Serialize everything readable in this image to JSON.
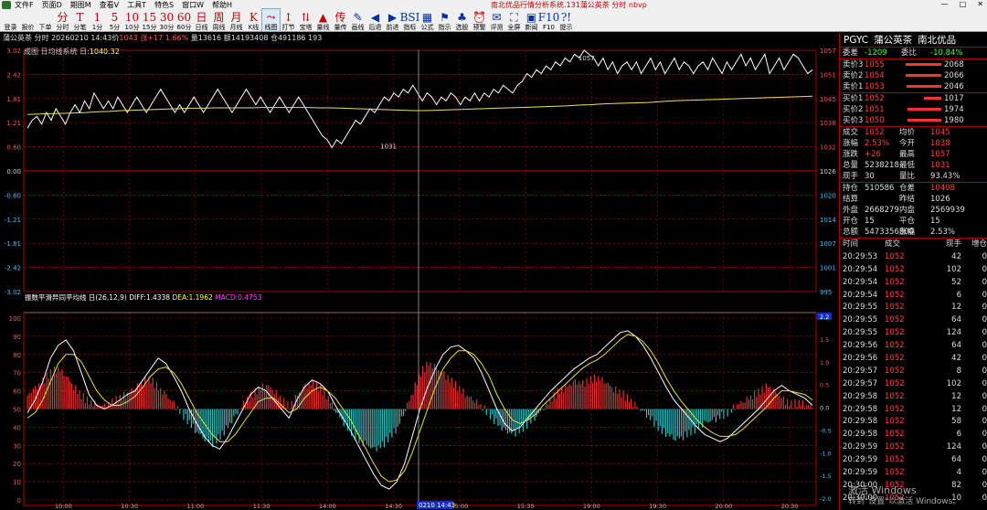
{
  "window": {
    "title": "南北优品行情分析系统.131蒲公英茶 分时 nbvp",
    "controls": [
      "—",
      "□",
      "✕"
    ]
  },
  "menu": [
    "文件F",
    "页面D",
    "期图M",
    "查看V",
    "工具T",
    "特色S",
    "窗口W",
    "帮助H"
  ],
  "toolbar": [
    {
      "g": "",
      "l": "登录",
      "icon": "login-icon"
    },
    {
      "g": "",
      "l": "报价",
      "icon": "quote-icon"
    },
    {
      "g": "",
      "l": "下单",
      "icon": "order-icon"
    },
    {
      "g": "分",
      "l": "分时",
      "icon": "timeshare-icon"
    },
    {
      "g": "T",
      "l": "分笔",
      "icon": "tick-icon"
    },
    {
      "g": "1",
      "l": "1分",
      "icon": "1min-icon"
    },
    {
      "g": "5",
      "l": "5分",
      "icon": "5min-icon"
    },
    {
      "g": "10",
      "l": "10分",
      "icon": "10min-icon"
    },
    {
      "g": "15",
      "l": "15分",
      "icon": "15min-icon"
    },
    {
      "g": "30",
      "l": "30分",
      "icon": "30min-icon"
    },
    {
      "g": "60",
      "l": "60分",
      "icon": "60min-icon"
    },
    {
      "g": "日",
      "l": "日线",
      "icon": "day-icon"
    },
    {
      "g": "周",
      "l": "周线",
      "icon": "week-icon"
    },
    {
      "g": "月",
      "l": "月线",
      "icon": "month-icon"
    },
    {
      "g": "K",
      "l": "K线",
      "icon": "kline-icon"
    },
    {
      "g": "⤳",
      "l": "线图",
      "icon": "linechart-icon"
    },
    {
      "g": "↕",
      "l": "打节",
      "icon": "bar-icon"
    },
    {
      "g": "⇅",
      "l": "宝塔",
      "icon": "tower-icon"
    },
    {
      "g": "▲",
      "l": "量线",
      "icon": "volume-icon"
    },
    {
      "g": "传",
      "l": "量传",
      "icon": "vtrans-icon"
    },
    {
      "g": "✎",
      "l": "画线",
      "icon": "draw-icon"
    },
    {
      "g": "◀",
      "l": "后退",
      "icon": "back-icon"
    },
    {
      "g": "▶",
      "l": "前进",
      "icon": "forward-icon"
    },
    {
      "g": "BSI",
      "l": "指标",
      "icon": "indicator-icon"
    },
    {
      "g": "▦",
      "l": "公式",
      "icon": "formula-icon"
    },
    {
      "g": "⚑",
      "l": "指示",
      "icon": "indicate-icon"
    },
    {
      "g": "♣",
      "l": "选股",
      "icon": "select-icon"
    },
    {
      "g": "⏰",
      "l": "预警",
      "icon": "alarm-icon"
    },
    {
      "g": "✉",
      "l": "评测",
      "icon": "eval-icon"
    },
    {
      "g": "⛶",
      "l": "全屏",
      "icon": "fullscreen-icon"
    },
    {
      "g": "▣",
      "l": "新闻",
      "icon": "news-icon"
    },
    {
      "g": "F10",
      "l": "F10",
      "icon": "f10-icon"
    },
    {
      "g": "?!",
      "l": "提示",
      "icon": "hint-icon"
    }
  ],
  "info_bar": {
    "name": "蒲公英茶 分时 20260210 14:43价",
    "price": "1043",
    "change": "涨+17 1.66%",
    "rest": "量13616 额14193408 仓491186 193"
  },
  "price_legend": {
    "text": "成图 日均线系统 日:",
    "val": "1040.32"
  },
  "macd_legend": {
    "text": "振数平滑异同平均线 日(26,12,9)",
    "diff": "DIFF:1.4338",
    "dea": "DEA:1.1962",
    "macd": "MACD:0.4753"
  },
  "cursor_label": "0210 14:43",
  "chart_data": [
    {
      "type": "line",
      "name": "price",
      "left_ticks": [
        "3.02",
        "2.42",
        "1.81",
        "1.21",
        "0.60",
        "0.00",
        "-0.60",
        "-1.21",
        "-1.81",
        "-2.42",
        "-3.02"
      ],
      "right_ticks": [
        "1057",
        "1051",
        "1045",
        "1038",
        "1032",
        "1026",
        "1020",
        "1014",
        "1007",
        "1001",
        "995"
      ],
      "ylim": [
        995,
        1057
      ],
      "annotations": [
        {
          "text": "1057",
          "x": 0.7,
          "y": 1057
        },
        {
          "text": "1031",
          "x": 0.45,
          "y": 1031
        }
      ],
      "series": [
        {
          "values": [
            1037,
            1039,
            1040,
            1038,
            1041,
            1039,
            1042,
            1040,
            1038,
            1041,
            1043,
            1041,
            1044,
            1042,
            1046,
            1044,
            1042,
            1044,
            1042,
            1045,
            1043,
            1041,
            1043,
            1045,
            1043,
            1041,
            1043,
            1045,
            1047,
            1045,
            1043,
            1041,
            1043,
            1041,
            1043,
            1045,
            1043,
            1041,
            1043,
            1045,
            1047,
            1045,
            1043,
            1041,
            1043,
            1045,
            1047,
            1045,
            1043,
            1045,
            1043,
            1041,
            1043,
            1045,
            1043,
            1041,
            1043,
            1045,
            1043,
            1041,
            1039,
            1037,
            1035,
            1034,
            1032,
            1034,
            1033,
            1035,
            1037,
            1039,
            1038,
            1040,
            1042,
            1041,
            1043,
            1045,
            1044,
            1046,
            1045,
            1047,
            1046,
            1048,
            1046,
            1044,
            1046,
            1045,
            1043,
            1045,
            1044,
            1046,
            1045,
            1043,
            1045,
            1044,
            1046,
            1044,
            1046,
            1045,
            1047,
            1046,
            1048,
            1047,
            1046,
            1048,
            1049,
            1051,
            1050,
            1052,
            1051,
            1053,
            1052,
            1054,
            1053,
            1055,
            1054,
            1056,
            1055,
            1057,
            1056,
            1055,
            1053,
            1055,
            1052,
            1054,
            1051,
            1053,
            1054,
            1052,
            1054,
            1051,
            1053,
            1055,
            1052,
            1054,
            1051,
            1053,
            1055,
            1052,
            1054,
            1053,
            1051,
            1053,
            1054,
            1052,
            1055,
            1053,
            1051,
            1054,
            1052,
            1054,
            1056,
            1053,
            1055,
            1052,
            1054,
            1056,
            1051,
            1053,
            1055,
            1052,
            1054,
            1056,
            1055,
            1053,
            1051,
            1052
          ]
        },
        {
          "values": [
            1040.5,
            1040.6,
            1040.7,
            1040.8,
            1040.9,
            1041,
            1041.2,
            1041.3,
            1041.5,
            1041.6,
            1041.7,
            1041.8,
            1041.9,
            1042,
            1042.1,
            1042.1,
            1042.2,
            1042.2,
            1042.2,
            1042.2,
            1042.3,
            1042.3,
            1042.3,
            1042.3,
            1042.3,
            1042.2,
            1042.2,
            1042.1,
            1042,
            1041.9,
            1041.8,
            1041.7,
            1041.6,
            1041.5,
            1041.5,
            1041.6,
            1041.7,
            1041.8,
            1041.9,
            1042,
            1042.1,
            1042.2,
            1042.3,
            1042.4,
            1042.5,
            1042.6,
            1042.7,
            1042.9,
            1043,
            1043.2,
            1043.3,
            1043.4,
            1043.5,
            1043.6,
            1043.8,
            1044,
            1044.1,
            1044.2,
            1044.3,
            1044.4,
            1044.5,
            1044.6,
            1044.7,
            1044.8,
            1044.9,
            1045,
            1045.1,
            1045.2
          ]
        }
      ]
    },
    {
      "type": "line",
      "name": "indicator",
      "left_ticks": [
        "100",
        "90",
        "80",
        "70",
        "60",
        "50",
        "40",
        "30",
        "20",
        "10",
        "0"
      ],
      "right_ticks": [
        "2.2",
        "1.5",
        "1.0",
        "0.5",
        "0.0",
        "-0.5",
        "-1.0",
        "-1.5",
        "-2.0"
      ],
      "ylim": [
        0,
        100
      ],
      "series": [
        {
          "values": [
            48,
            55,
            65,
            78,
            85,
            88,
            82,
            70,
            58,
            52,
            50,
            52,
            55,
            58,
            60,
            66,
            72,
            78,
            75,
            68,
            60,
            50,
            42,
            35,
            30,
            28,
            34,
            42,
            50,
            58,
            62,
            60,
            55,
            50,
            45,
            55,
            62,
            66,
            64,
            60,
            52,
            45,
            38,
            30,
            22,
            14,
            8,
            6,
            10,
            20,
            35,
            50,
            62,
            72,
            80,
            84,
            85,
            82,
            78,
            70,
            60,
            50,
            42,
            38,
            40,
            45,
            50,
            55,
            60,
            64,
            68,
            72,
            75,
            78,
            80,
            84,
            88,
            92,
            93,
            90,
            85,
            78,
            70,
            62,
            55,
            50,
            45,
            40,
            36,
            34,
            32,
            34,
            38,
            42,
            46,
            50,
            55,
            60,
            63,
            60,
            58,
            56,
            52
          ]
        },
        {
          "values": [
            45,
            48,
            55,
            65,
            75,
            80,
            80,
            76,
            68,
            60,
            55,
            52,
            52,
            54,
            57,
            62,
            68,
            72,
            73,
            70,
            64,
            56,
            48,
            42,
            36,
            32,
            32,
            36,
            42,
            48,
            54,
            56,
            56,
            52,
            48,
            50,
            56,
            60,
            62,
            60,
            56,
            50,
            44,
            36,
            28,
            20,
            13,
            10,
            11,
            16,
            26,
            38,
            50,
            62,
            72,
            78,
            82,
            82,
            80,
            75,
            68,
            58,
            50,
            44,
            42,
            44,
            47,
            52,
            56,
            60,
            64,
            68,
            72,
            75,
            77,
            80,
            84,
            88,
            91,
            90,
            87,
            82,
            75,
            67,
            60,
            54,
            49,
            44,
            40,
            37,
            35,
            35,
            36,
            39,
            43,
            47,
            51,
            56,
            60,
            60,
            59,
            58,
            55
          ]
        },
        {
          "values": [
            0.6,
            0.9,
            1.2,
            1.6,
            1.8,
            1.5,
            1.0,
            0.6,
            0.3,
            0.2,
            0.1,
            0.3,
            0.5,
            0.7,
            1.0,
            1.2,
            1.3,
            0.9,
            0.6,
            0.2,
            -0.2,
            -0.6,
            -1.0,
            -1.3,
            -1.5,
            -1.2,
            -0.8,
            -0.3,
            0.2,
            0.6,
            0.9,
            1.1,
            0.8,
            0.4,
            0.1,
            0.6,
            1.0,
            1.1,
            0.9,
            0.5,
            -0.1,
            -0.6,
            -1.0,
            -1.4,
            -1.6,
            -1.8,
            -1.6,
            -1.2,
            -0.8,
            0.0,
            0.8,
            1.6,
            2.0,
            1.8,
            1.5,
            1.2,
            0.9,
            0.6,
            0.4,
            0.1,
            -0.3,
            -0.7,
            -1.0,
            -1.1,
            -0.9,
            -0.6,
            -0.3,
            0.1,
            0.5,
            0.8,
            1.0,
            1.2,
            1.1,
            1.3,
            1.4,
            1.2,
            0.9,
            0.7,
            0.4,
            0.1,
            -0.2,
            -0.5,
            -0.9,
            -1.1,
            -1.3,
            -1.2,
            -1.0,
            -0.8,
            -0.6,
            -0.5,
            -0.3,
            -0.1,
            0.2,
            0.4,
            0.6,
            0.8,
            1.0,
            0.7,
            0.4,
            0.2,
            0.3,
            0.2,
            0.1
          ]
        }
      ]
    }
  ],
  "x_ticks": [
    "10:00",
    "10:30",
    "11:00",
    "11:30",
    "14:00",
    "14:30",
    "15:00",
    "15:30",
    "19:00",
    "19:30",
    "20:00",
    "20:30"
  ],
  "right_panel": {
    "code": "PGYC",
    "name": "蒲公英茶",
    "category": "南北优品",
    "weibi": {
      "l1": "委差",
      "v1": "-1209",
      "l2": "委比",
      "v2": "-10.84%"
    },
    "asks": [
      {
        "label": "卖价3",
        "price": "1055",
        "vol": "2068",
        "bar": 0.97
      },
      {
        "label": "卖价2",
        "price": "1054",
        "vol": "2066",
        "bar": 0.97
      },
      {
        "label": "卖价1",
        "price": "1053",
        "vol": "2046",
        "bar": 0.96
      }
    ],
    "bids": [
      {
        "label": "买价1",
        "price": "1052",
        "vol": "1017",
        "bar": 0.48
      },
      {
        "label": "买价2",
        "price": "1051",
        "vol": "1974",
        "bar": 0.93
      },
      {
        "label": "买价3",
        "price": "1050",
        "vol": "1980",
        "bar": 0.93
      }
    ],
    "stats": [
      {
        "k1": "成交",
        "v1": "1052",
        "c1": "red",
        "k2": "均价",
        "v2": "1045",
        "c2": "red"
      },
      {
        "k1": "涨幅",
        "v1": "2.53%",
        "c1": "red",
        "k2": "今开",
        "v2": "1038",
        "c2": "red"
      },
      {
        "k1": "涨跌",
        "v1": "+26",
        "c1": "red",
        "k2": "最高",
        "v2": "1057",
        "c2": "red"
      },
      {
        "k1": "总量",
        "v1": "5238218",
        "c1": "white",
        "k2": "最低",
        "v2": "1031",
        "c2": "red"
      },
      {
        "k1": "现手",
        "v1": "30",
        "c1": "white",
        "k2": "量比",
        "v2": "93.43%",
        "c2": "white"
      }
    ],
    "stats2": [
      {
        "k1": "持仓",
        "v1": "510586",
        "c1": "white",
        "k2": "仓差",
        "v2": "10408",
        "c2": "red"
      },
      {
        "k1": "结算",
        "v1": "",
        "c1": "white",
        "k2": "昨结",
        "v2": "1026",
        "c2": "white"
      },
      {
        "k1": "外盘",
        "v1": "2668279",
        "c1": "white",
        "k2": "内盘",
        "v2": "2569939",
        "c2": "white"
      },
      {
        "k1": "开仓",
        "v1": "15",
        "c1": "white",
        "k2": "平仓",
        "v2": "15",
        "c2": "white"
      },
      {
        "k1": "总额",
        "v1": "5473356800",
        "c1": "white",
        "k2": "涨幅",
        "v2": "2.53%",
        "c2": "white"
      }
    ],
    "trades_header": [
      "时间",
      "成交",
      "现手",
      "增仓"
    ],
    "trades": [
      [
        "20:29:53",
        "1052",
        "42",
        "0"
      ],
      [
        "20:29:54",
        "1052",
        "102",
        "0"
      ],
      [
        "20:29:54",
        "1052",
        "52",
        "0"
      ],
      [
        "20:29:54",
        "1052",
        "6",
        "0"
      ],
      [
        "20:29:55",
        "1052",
        "12",
        "0"
      ],
      [
        "20:29:55",
        "1052",
        "64",
        "0"
      ],
      [
        "20:29:55",
        "1052",
        "124",
        "0"
      ],
      [
        "20:29:56",
        "1052",
        "64",
        "0"
      ],
      [
        "20:29:56",
        "1052",
        "42",
        "0"
      ],
      [
        "20:29:57",
        "1052",
        "8",
        "0"
      ],
      [
        "20:29:57",
        "1052",
        "102",
        "0"
      ],
      [
        "20:29:58",
        "1052",
        "12",
        "0"
      ],
      [
        "20:29:58",
        "1052",
        "12",
        "0"
      ],
      [
        "20:29:58",
        "1052",
        "58",
        "0"
      ],
      [
        "20:29:58",
        "1052",
        "6",
        "0"
      ],
      [
        "20:29:59",
        "1052",
        "124",
        "0"
      ],
      [
        "20:29:59",
        "1052",
        "64",
        "0"
      ],
      [
        "20:29:59",
        "1052",
        "4",
        "0"
      ],
      [
        "20:30:00",
        "1052",
        "82",
        "0"
      ],
      [
        "20:30:00",
        "1052",
        "10",
        "0"
      ]
    ]
  },
  "watermark": {
    "line1": "激活 Windows",
    "line2": "转到\"设置\"以激活 Windows。"
  }
}
